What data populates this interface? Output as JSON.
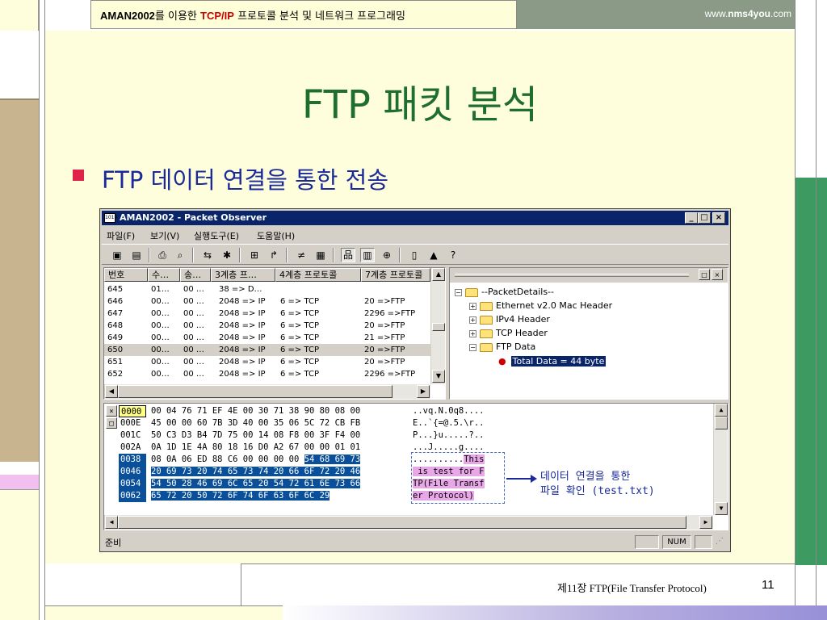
{
  "header": {
    "title_brand": "AMAN2002",
    "title_mid1": "를 이용한 ",
    "title_proto": "TCP/IP",
    "title_mid2": " 프로토콜 분석 및 네트워크 프로그래밍",
    "url_prefix": "www.",
    "url_bold": "nms4you",
    "url_suffix": ".com"
  },
  "slide": {
    "title": "FTP 패킷 분석",
    "bullet": "FTP 데이터 연결을 통한 전송",
    "footer": "제11장 FTP(File Transfer Protocol)",
    "page_number": "11"
  },
  "window": {
    "title": "AMAN2002 - Packet Observer",
    "icon_label": "1010",
    "controls": {
      "minimize": "_",
      "maximize": "□",
      "close": "×"
    },
    "menu": [
      "파일(F)",
      "보기(V)",
      "실행도구(E)",
      "도움말(H)"
    ],
    "toolbar_icons": [
      "graph-icon",
      "binary-icon",
      "print-icon",
      "print-preview-icon",
      "capture-icon",
      "filter-icon",
      "find-icon",
      "goto-icon",
      "protocol-icon",
      "color-icon",
      "tree-view-icon",
      "hex-view-icon",
      "zoom-icon",
      "copy-icon",
      "bookmark-icon",
      "help-icon"
    ],
    "toolbar_glyphs": [
      "▣",
      "▤",
      "⎙",
      "⌕",
      "⇆",
      "✱",
      "⊞",
      "↱",
      "≠",
      "▦",
      "品",
      "▥",
      "⊕",
      "▯",
      "▲",
      "?"
    ],
    "list_columns": [
      "번호",
      "수…",
      "송…",
      "3계층 프…",
      "4계층 프로토콜",
      "7계층 프로토콜"
    ],
    "list_rows": [
      [
        "645",
        "01…",
        "00 …",
        "38 => D…",
        "",
        ""
      ],
      [
        "646",
        "00…",
        "00 …",
        "2048 => IP",
        "6 => TCP",
        "20 =>FTP"
      ],
      [
        "647",
        "00…",
        "00 …",
        "2048 => IP",
        "6 => TCP",
        "2296 =>FTP"
      ],
      [
        "648",
        "00…",
        "00 …",
        "2048 => IP",
        "6 => TCP",
        "20 =>FTP"
      ],
      [
        "649",
        "00…",
        "00 …",
        "2048 => IP",
        "6 => TCP",
        "21 =>FTP"
      ],
      [
        "650",
        "00…",
        "00 …",
        "2048 => IP",
        "6 => TCP",
        "20 =>FTP"
      ],
      [
        "651",
        "00…",
        "00 …",
        "2048 => IP",
        "6 => TCP",
        "20 =>FTP"
      ],
      [
        "652",
        "00…",
        "00 …",
        "2048 => IP",
        "6 => TCP",
        "2296 =>FTP"
      ]
    ],
    "tree": {
      "root": "--PacketDetails--",
      "children": [
        "Ethernet v2.0 Mac Header",
        "IPv4 Header",
        "TCP Header",
        "FTP Data"
      ],
      "selected_leaf": "Total Data = 44 byte"
    },
    "hex_rows": [
      {
        "offset": "0000",
        "hex": "00 04 76 71 EF 4E 00 30 71 38 90 80 08 00",
        "ascii": "..vq.N.0q8...."
      },
      {
        "offset": "000E",
        "hex": "45 00 00 60 7B 3D 40 00 35 06 5C 72 CB FB",
        "ascii": "E..`{=@.5.\\r.."
      },
      {
        "offset": "001C",
        "hex": "50 C3 D3 B4 7D 75 00 14 08 F8 00 3F F4 00",
        "ascii": "P...}u.....?.."
      },
      {
        "offset": "002A",
        "hex": "0A 1D 1E 4A 80 18 16 D0 A2 67 00 00 01 01",
        "ascii": "...J.....g...."
      },
      {
        "offset": "0038",
        "hex_plain": "08 0A 06 ED 88 C6 00 00 00 00 ",
        "hex_hl": "54 68 69 73",
        "ascii_plain": "..........",
        "ascii_hl": "This"
      },
      {
        "offset": "0046",
        "hex_hl": "20 69 73 20 74 65 73 74 20 66 6F 72 20 46",
        "ascii_hl": " is test for F"
      },
      {
        "offset": "0054",
        "hex_hl": "54 50 28 46 69 6C 65 20 54 72 61 6E 73 66",
        "ascii_hl": "TP(File Transf"
      },
      {
        "offset": "0062",
        "hex_hl": "65 72 20 50 72 6F 74 6F 63 6F 6C 29",
        "ascii_hl": "er Protocol)"
      }
    ],
    "annotation_line1": "데이터 연결을 통한",
    "annotation_line2": "파일 확인 (test.txt)",
    "status": "준비",
    "status_num": "NUM"
  },
  "colors": {
    "title_green": "#1e6e2e",
    "bullet_red": "#e0214a",
    "text_blue": "#1a2a9a",
    "titlebar": "#0a246a",
    "hex_highlight": "#0a4f9a",
    "ascii_highlight": "#e8a8e8"
  }
}
